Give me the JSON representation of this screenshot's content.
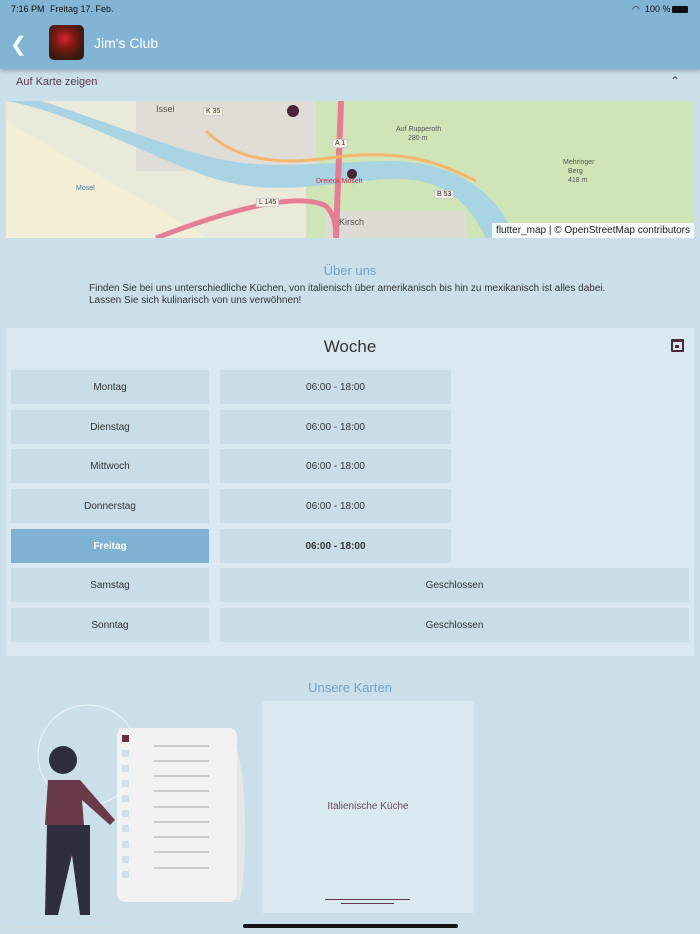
{
  "status": {
    "time": "7:16 PM",
    "date": "Freitag 17. Feb.",
    "battery": "100 %"
  },
  "header": {
    "title": "Jim's Club"
  },
  "map_toggle": {
    "label": "Auf Karte zeigen"
  },
  "map": {
    "attribution": "flutter_map | © OpenStreetMap contributors",
    "labels": [
      "Issel",
      "K 35",
      "A 1",
      "Auf Rupperoth",
      "280 m",
      "Mehringer",
      "Berg",
      "418 m",
      "B 53",
      "L 145",
      "Kirsch",
      "Dreieck Moselt",
      "Mosel"
    ]
  },
  "about": {
    "title": "Über uns",
    "line1": "Finden Sie bei uns unterschiedliche Küchen, von italienisch über amerikanisch bis hin zu mexikanisch ist alles dabei.",
    "line2": "Lassen Sie sich kulinarisch von uns verwöhnen!"
  },
  "hours": {
    "title": "Woche",
    "days": [
      {
        "day": "Montag",
        "time": "06:00 - 18:00"
      },
      {
        "day": "Dienstag",
        "time": "06:00 - 18:00"
      },
      {
        "day": "Mittwoch",
        "time": "06:00 - 18:00"
      },
      {
        "day": "Donnerstag",
        "time": "06:00 - 18:00"
      },
      {
        "day": "Freitag",
        "time": "06:00 - 18:00"
      },
      {
        "day": "Samstag",
        "time": "Geschlossen"
      },
      {
        "day": "Sonntag",
        "time": "Geschlossen"
      }
    ]
  },
  "menus": {
    "title": "Unsere Karten",
    "items": [
      {
        "label": "Italienische Küche"
      }
    ]
  }
}
